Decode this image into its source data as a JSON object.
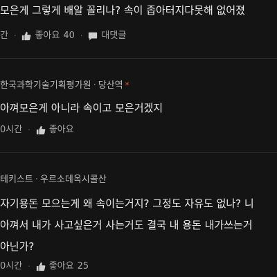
{
  "comments": [
    {
      "text": "모은게 그렇게 배알 꼴리나? 속이 좁아터지다못해 없어졌",
      "time": "간",
      "like_label": "좋아요",
      "like_count": "40",
      "reply_label": "대댓글"
    },
    {
      "author": "한국과학기술기획평가원",
      "location": "당산역",
      "star": "*",
      "text": "아껴모은게 아니라 속이고 모은거겠지",
      "time": "0시간",
      "like_label": "좋아요"
    },
    {
      "author": "테키스트",
      "location": "우르소데옥시콜산",
      "text_lines": [
        "자기용돈 모으는게 왜 속이는거지? 그정도 자유도 없나? 니",
        "아껴서 내가 사고싶은거 사는거도 결국 내 용돈 내가쓰는거",
        "아닌가?"
      ],
      "time": "0시간",
      "like_label": "좋아요",
      "like_count": "25"
    }
  ]
}
